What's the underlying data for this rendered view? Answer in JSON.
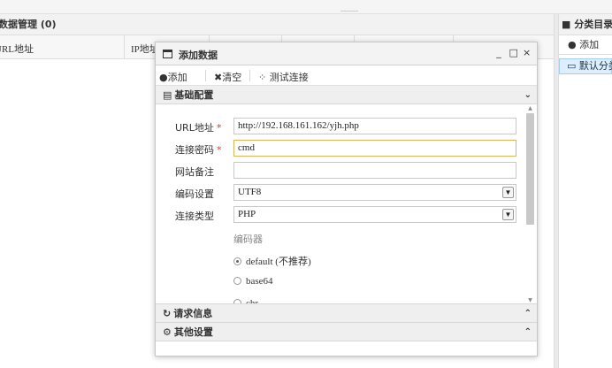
{
  "main": {
    "title": "数据管理 (0)",
    "columns": [
      "URL地址",
      "IP地址"
    ]
  },
  "side": {
    "title": "分类目录 (",
    "add_label": "添加",
    "default_category": "默认分类"
  },
  "dialog": {
    "title": "添加数据",
    "window_buttons": {
      "minimize": "_",
      "maximize": "□",
      "close": "×"
    },
    "toolbar": {
      "add": "添加",
      "clear": "清空",
      "test": "测试连接"
    },
    "sections": {
      "basic": "基础配置",
      "request": "请求信息",
      "other": "其他设置"
    },
    "form": {
      "url": {
        "label": "URL地址",
        "required": "*",
        "value": "http://192.168.161.162/yjh.php"
      },
      "password": {
        "label": "连接密码",
        "required": "*",
        "value": "cmd"
      },
      "note": {
        "label": "网站备注",
        "value": ""
      },
      "encoding": {
        "label": "编码设置",
        "value": "UTF8"
      },
      "type": {
        "label": "连接类型",
        "value": "PHP"
      },
      "encoder_label": "编码器",
      "encoders": [
        {
          "label": "default (不推荐)",
          "selected": true
        },
        {
          "label": "base64",
          "selected": false
        },
        {
          "label": "chr",
          "selected": false
        }
      ]
    }
  }
}
